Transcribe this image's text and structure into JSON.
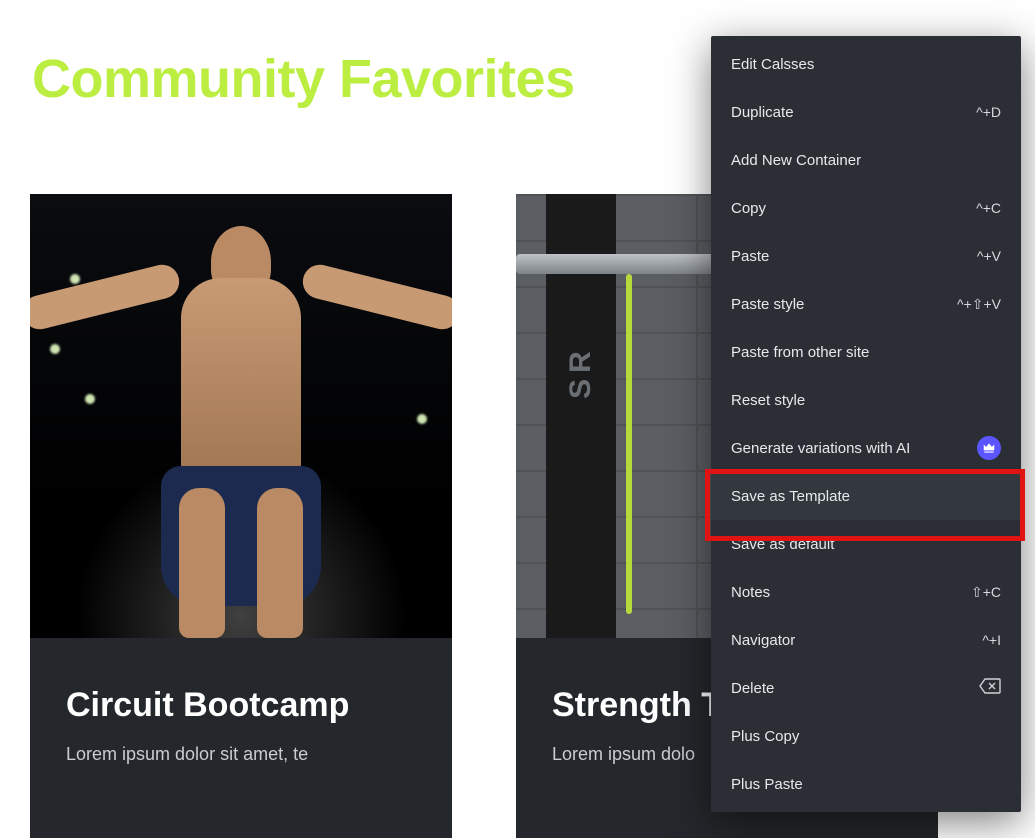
{
  "header": {
    "title": "Community Favorites"
  },
  "cards": [
    {
      "title": "Circuit Bootcamp",
      "desc": "Lorem ipsum dolor sit amet, te"
    },
    {
      "title": "Strength T",
      "desc": "Lorem ipsum dolo"
    }
  ],
  "contextMenu": {
    "items": [
      {
        "label": "Edit Calsses",
        "shortcut": ""
      },
      {
        "label": "Duplicate",
        "shortcut": "^+D"
      },
      {
        "label": "Add New Container",
        "shortcut": ""
      },
      {
        "label": "Copy",
        "shortcut": "^+C"
      },
      {
        "label": "Paste",
        "shortcut": "^+V"
      },
      {
        "label": "Paste style",
        "shortcut": "^+⇧+V"
      },
      {
        "label": "Paste from other site",
        "shortcut": ""
      },
      {
        "label": "Reset style",
        "shortcut": ""
      },
      {
        "label": "Generate variations with AI",
        "shortcut": "",
        "badge": true
      },
      {
        "label": "Save as Template",
        "shortcut": "",
        "hover": true,
        "highlight": true
      },
      {
        "label": "Save as default",
        "shortcut": ""
      },
      {
        "label": "Notes",
        "shortcut": "⇧+C"
      },
      {
        "label": "Navigator",
        "shortcut": "^+I"
      },
      {
        "label": "Delete",
        "shortcut": "",
        "deleteIcon": true
      },
      {
        "label": "Plus Copy",
        "shortcut": ""
      },
      {
        "label": "Plus Paste",
        "shortcut": ""
      }
    ]
  }
}
